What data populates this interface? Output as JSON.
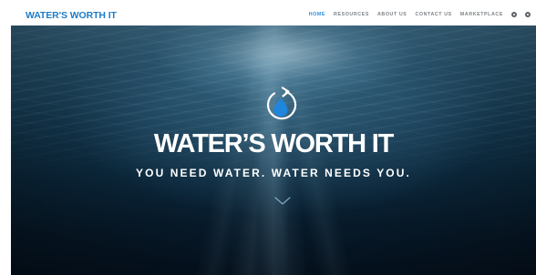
{
  "navbar": {
    "brand": "WATER'S WORTH IT",
    "links": [
      {
        "label": "HOME",
        "active": true
      },
      {
        "label": "RESOURCES",
        "active": false
      },
      {
        "label": "ABOUT US",
        "active": false
      },
      {
        "label": "CONTACT US",
        "active": false
      },
      {
        "label": "MARKETPLACE",
        "active": false
      }
    ],
    "icons": [
      "settings-icon",
      "user-icon"
    ]
  },
  "hero": {
    "title": "WATER’S WORTH IT",
    "subtitle": "YOU NEED WATER. WATER NEEDS YOU.",
    "logo_icon": "water-drop-refresh-icon",
    "scroll_icon": "chevron-down-icon"
  },
  "colors": {
    "brand_blue": "#1e7cc8",
    "nav_active": "#2a8ddc",
    "nav_text": "#7d8287",
    "drop_fill": "#1f86dc",
    "hero_deep": "#071a2a"
  }
}
